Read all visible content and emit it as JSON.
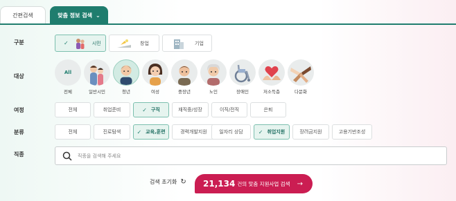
{
  "tabs": {
    "simple": "간편검색",
    "custom": "맞춤 정보 검색"
  },
  "labels": {
    "category": "구분",
    "target": "대상",
    "journey": "여정",
    "classification": "분류",
    "job": "직종"
  },
  "category_items": [
    {
      "label": "시민",
      "selected": true,
      "icon": "citizen-illustration"
    },
    {
      "label": "창업",
      "selected": false,
      "icon": "startup-illustration"
    },
    {
      "label": "기업",
      "selected": false,
      "icon": "building-illustration"
    }
  ],
  "target_items": [
    {
      "label": "전체",
      "text": "All",
      "selected": false
    },
    {
      "label": "일반시민",
      "selected": false,
      "icon": "family-avatar"
    },
    {
      "label": "청년",
      "selected": true,
      "icon": "youth-avatar"
    },
    {
      "label": "여성",
      "selected": false,
      "icon": "woman-avatar"
    },
    {
      "label": "중장년",
      "selected": false,
      "icon": "middle-aged-avatar"
    },
    {
      "label": "노인",
      "selected": false,
      "icon": "elderly-avatar"
    },
    {
      "label": "장애인",
      "selected": false,
      "icon": "wheelchair-icon"
    },
    {
      "label": "저소득층",
      "selected": false,
      "icon": "heart-hands-icon"
    },
    {
      "label": "다문화",
      "selected": false,
      "icon": "multicultural-hands-icon"
    }
  ],
  "journey_items": [
    {
      "label": "전체",
      "selected": false
    },
    {
      "label": "취업준비",
      "selected": false
    },
    {
      "label": "구직",
      "selected": true
    },
    {
      "label": "재직중/성장",
      "selected": false
    },
    {
      "label": "이직/전직",
      "selected": false
    },
    {
      "label": "은퇴",
      "selected": false
    }
  ],
  "class_items": [
    {
      "label": "전체",
      "selected": false
    },
    {
      "label": "진로탐색",
      "selected": false
    },
    {
      "label": "교육,훈련",
      "selected": true
    },
    {
      "label": "경력개발지원",
      "selected": false
    },
    {
      "label": "일자리 상담",
      "selected": false
    },
    {
      "label": "취업지원",
      "selected": true
    },
    {
      "label": "장려금지원",
      "selected": false
    },
    {
      "label": "고용기반조성",
      "selected": false
    }
  ],
  "search": {
    "placeholder": "직종을 검색해 주세요"
  },
  "reset_label": "검색 초기화",
  "cta": {
    "count": "21,134",
    "text": "건의 맞춤 지원사업 검색",
    "arrow": "→"
  },
  "colors": {
    "primary": "#1f7d6e",
    "cta": "#cb1d52",
    "selected_bg": "#e6f4ef"
  }
}
